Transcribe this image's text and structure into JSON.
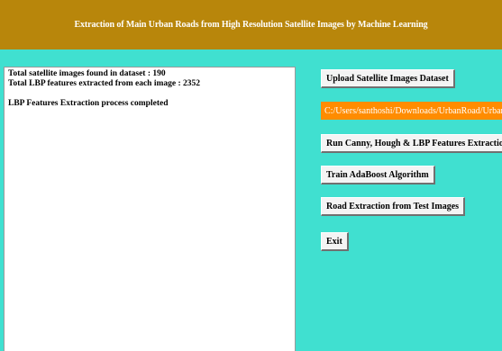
{
  "title": "Extraction of Main Urban Roads from High Resolution Satellite Images by Machine Learning",
  "output": {
    "lines": [
      "Total satellite images found in dataset : 190",
      "Total LBP features extracted from each image : 2352",
      "",
      "LBP Features Extraction process completed"
    ]
  },
  "controls": {
    "upload_label": "Upload Satellite Images Dataset",
    "path_value": "C:/Users/santhoshi/Downloads/UrbanRoad/UrbanRoad",
    "features_label": "Run Canny, Hough & LBP Features Extraction Algorithm",
    "train_label": "Train AdaBoost Algorithm",
    "road_label": "Road Extraction from Test Images",
    "exit_label": "Exit"
  },
  "colors": {
    "background": "#40E0D0",
    "title_bar": "#B8860B",
    "path_label": "#FF8C00"
  }
}
